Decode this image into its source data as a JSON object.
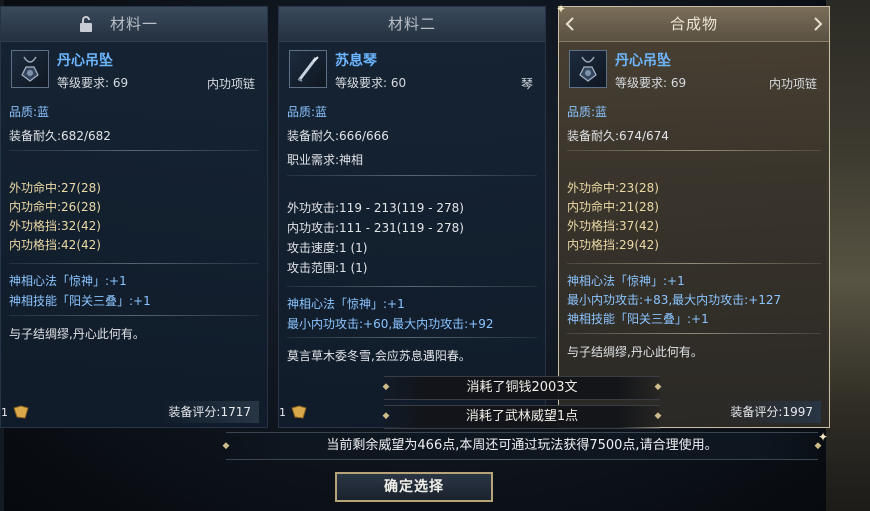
{
  "colors": {
    "quality_blue": "#8bc4ff",
    "name_blue": "#6cb6ff",
    "stat_gold": "#ecd9a5",
    "result_border": "#c9bfa4"
  },
  "panels": [
    {
      "title": "材料一",
      "item_name": "丹心吊坠",
      "level_label": "等级要求:",
      "level_value": "69",
      "slot": "内功项链",
      "quality": "品质:蓝",
      "durability": "装备耐久:682/682",
      "stats": [
        "外功命中:27(28)",
        "内功命中:26(28)",
        "外功格挡:32(42)",
        "内功格挡:42(42)"
      ],
      "skills": [
        "神相心法「惊神」:+1",
        "神相技能「阳关三叠」:+1"
      ],
      "desc": "与子结绸缪,丹心此何有。",
      "count": "1",
      "score": "装备评分:1717"
    },
    {
      "title": "材料二",
      "item_name": "苏息琴",
      "level_label": "等级要求:",
      "level_value": "60",
      "slot": "琴",
      "quality": "品质:蓝",
      "durability": "装备耐久:666/666",
      "requirement": "职业需求:神相",
      "stats": [
        "外功攻击:119 - 213(119 - 278)",
        "内功攻击:111 - 231(119 - 278)",
        "攻击速度:1 (1)",
        "攻击范围:1 (1)"
      ],
      "skills": [
        "神相心法「惊神」:+1",
        "最小内功攻击:+60,最大内功攻击:+92"
      ],
      "desc": "莫言草木委冬雪,会应苏息遇阳春。",
      "count": "1"
    },
    {
      "title": "合成物",
      "item_name": "丹心吊坠",
      "level_label": "等级要求:",
      "level_value": "69",
      "slot": "内功项链",
      "quality": "品质:蓝",
      "durability": "装备耐久:674/674",
      "stats": [
        "外功命中:23(28)",
        "内功命中:21(28)",
        "外功格挡:37(42)",
        "内功格挡:29(42)"
      ],
      "skills": [
        "神相心法「惊神」:+1",
        "最小内功攻击:+83,最大内功攻击:+127",
        "神相技能「阳关三叠」:+1"
      ],
      "desc": "与子结绸缪,丹心此何有。",
      "score": "装备评分:1997"
    }
  ],
  "cost_1": "消耗了铜钱2003文",
  "cost_2": "消耗了武林威望1点",
  "info": "当前剩余威望为466点,本周还可通过玩法获得7500点,请合理使用。",
  "confirm_label": "确定选择"
}
